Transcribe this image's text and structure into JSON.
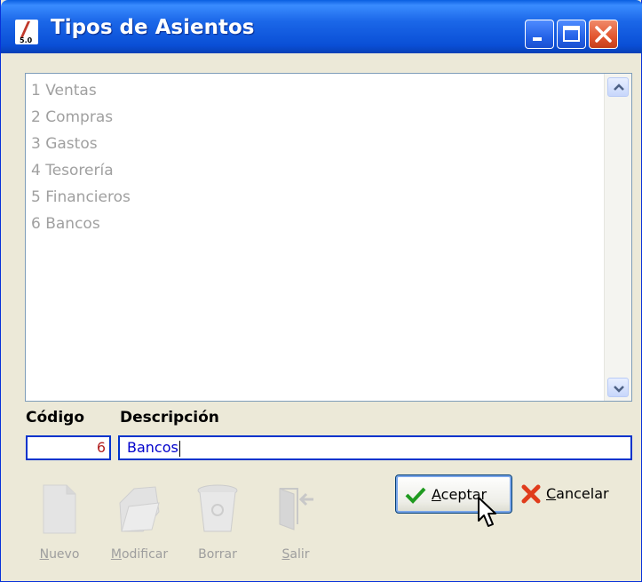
{
  "window": {
    "title": "Tipos de Asientos",
    "app_icon_text": "5.0",
    "controls": [
      "minimize",
      "maximize",
      "close"
    ]
  },
  "list": {
    "items": [
      "1 Ventas",
      "2 Compras",
      "3 Gastos",
      "4 Tesorería",
      "5 Financieros",
      "6 Bancos"
    ]
  },
  "form": {
    "codigo_label": "Código",
    "descripcion_label": "Descripción",
    "codigo_value": "6",
    "descripcion_value": "Bancos"
  },
  "toolbar": {
    "nuevo": {
      "key": "N",
      "rest": "uevo"
    },
    "modificar": {
      "key": "M",
      "rest": "odificar"
    },
    "borrar": {
      "label": "Borrar"
    },
    "salir": {
      "key": "S",
      "rest": "alir"
    }
  },
  "buttons": {
    "aceptar": {
      "key": "A",
      "rest": "ceptar"
    },
    "cancelar": {
      "key": "C",
      "rest": "ancelar"
    }
  },
  "colors": {
    "titlebar": "#0a4fd6",
    "accent_input_border": "#0033cc",
    "codigo_text": "#b22222",
    "descripcion_text": "#0000cc",
    "disabled_text": "#9e9e9e"
  },
  "icons": [
    "app-icon",
    "minimize-icon",
    "maximize-icon",
    "close-icon",
    "scroll-up-icon",
    "scroll-down-icon",
    "new-document-icon",
    "open-folder-icon",
    "trash-bin-icon",
    "exit-door-icon",
    "checkmark-icon",
    "red-x-icon",
    "mouse-cursor-icon"
  ]
}
